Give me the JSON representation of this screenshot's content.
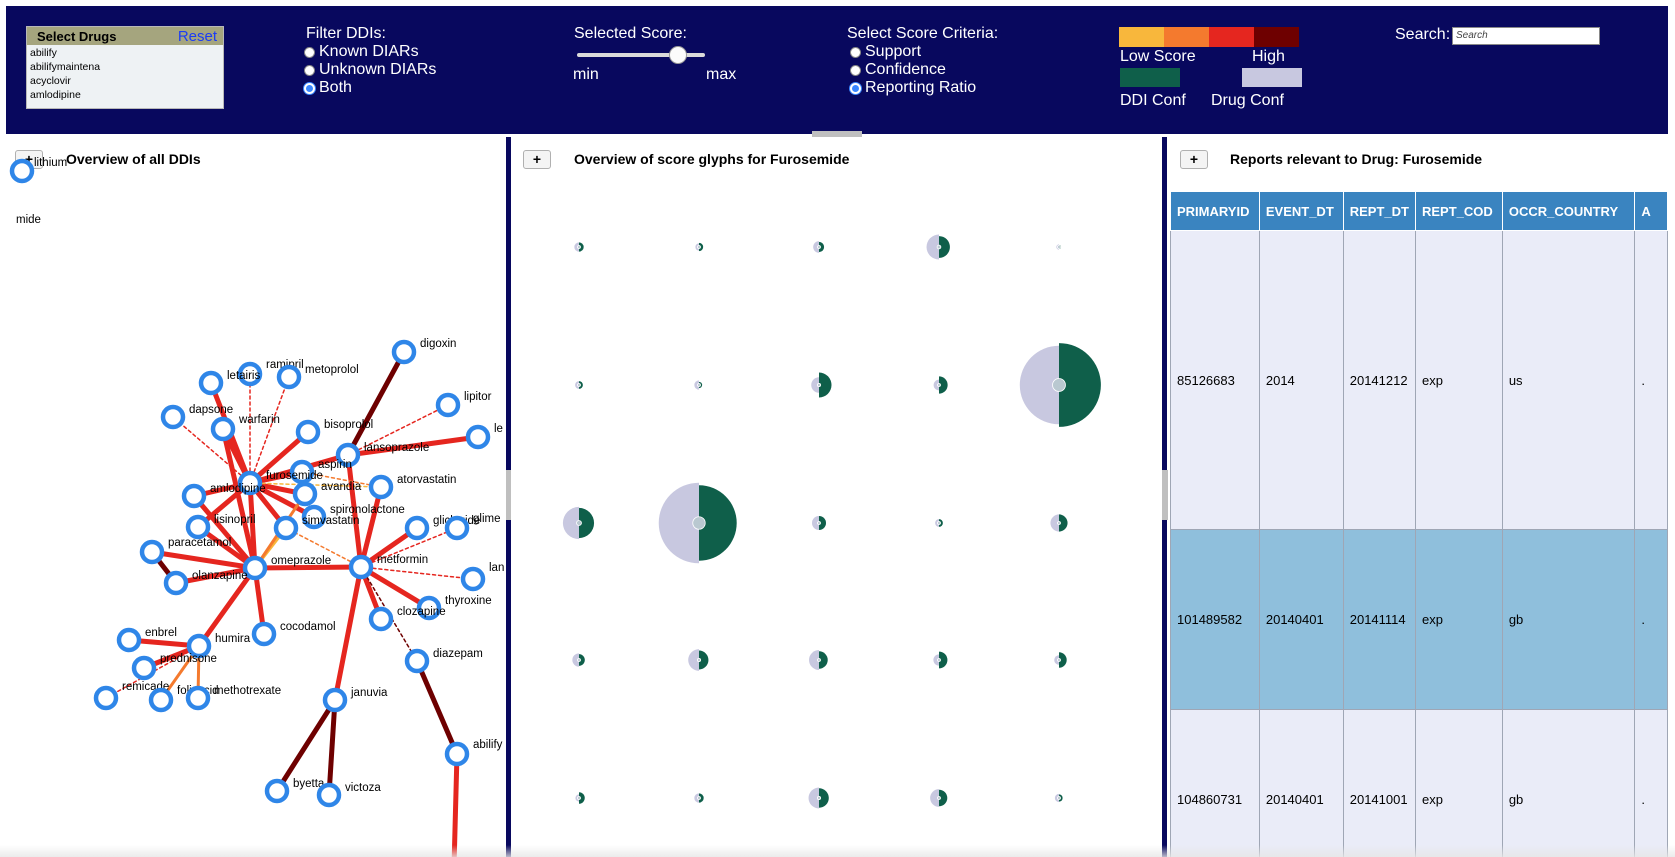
{
  "header": {
    "select_drugs": {
      "title": "Select Drugs",
      "reset_label": "Reset",
      "items": [
        "abilify",
        "abilifymaintena",
        "acyclovir",
        "amlodipine"
      ]
    },
    "filter_ddis": {
      "title": "Filter DDIs:",
      "options": [
        "Known DIARs",
        "Unknown DIARs",
        "Both"
      ],
      "selected": "Both"
    },
    "score": {
      "title": "Selected Score:",
      "min_label": "min",
      "max_label": "max",
      "level": 0.78
    },
    "criteria": {
      "title": "Select Score Criteria:",
      "options": [
        "Support",
        "Confidence",
        "Reporting Ratio"
      ],
      "selected": "Reporting Ratio"
    },
    "legend": {
      "scale_colors": [
        "#f8b73c",
        "#f47a2e",
        "#e5261f",
        "#6e0000"
      ],
      "low_label": "Low Score",
      "high_label": "High",
      "ddi_conf_label": "DDI Conf",
      "drug_conf_label": "Drug Conf",
      "ddi_conf_color": "#0f5f4a",
      "drug_conf_color": "#c8c8e0"
    },
    "search": {
      "label": "Search:",
      "placeholder": "Search"
    }
  },
  "panels": {
    "left_title": "Overview of all DDIs",
    "mid_title": "Overview of score glyphs for Furosemide",
    "right_title": "Reports relevant to Drug: Furosemide",
    "expand_label": "+"
  },
  "network": {
    "nodes": [
      {
        "id": "lithium",
        "label": "lithium"
      },
      {
        "id": "furosemide_partial",
        "label": "mide"
      },
      {
        "id": "digoxin",
        "label": "digoxin"
      },
      {
        "id": "ramipril",
        "label": "ramipril"
      },
      {
        "id": "letairis",
        "label": "letairis"
      },
      {
        "id": "metoprolol",
        "label": "metoprolol"
      },
      {
        "id": "lipitor",
        "label": "lipitor"
      },
      {
        "id": "dapsone",
        "label": "dapsone"
      },
      {
        "id": "warfarin",
        "label": "warfarin"
      },
      {
        "id": "bisoprolol",
        "label": "bisoprolol"
      },
      {
        "id": "le",
        "label": "le"
      },
      {
        "id": "lansoprazole",
        "label": "lansoprazole"
      },
      {
        "id": "aspirin",
        "label": "aspirin"
      },
      {
        "id": "furosemide",
        "label": "furosemide"
      },
      {
        "id": "amlodipine",
        "label": "amlodipine"
      },
      {
        "id": "avandia",
        "label": "avandia"
      },
      {
        "id": "atorvastatin",
        "label": "atorvastatin"
      },
      {
        "id": "spironolactone",
        "label": "spironolactone"
      },
      {
        "id": "lisinopril",
        "label": "lisinopril"
      },
      {
        "id": "simvastatin",
        "label": "simvastatin"
      },
      {
        "id": "gliclazide",
        "label": "gliclazide"
      },
      {
        "id": "glime",
        "label": "glime"
      },
      {
        "id": "paracetamol",
        "label": "paracetamol"
      },
      {
        "id": "omeprazole",
        "label": "omeprazole"
      },
      {
        "id": "metformin",
        "label": "metformin"
      },
      {
        "id": "olanzapine",
        "label": "olanzapine"
      },
      {
        "id": "lan",
        "label": "lan"
      },
      {
        "id": "thyroxine",
        "label": "thyroxine"
      },
      {
        "id": "clozapine",
        "label": "clozapine"
      },
      {
        "id": "cocodamol",
        "label": "cocodamol"
      },
      {
        "id": "enbrel",
        "label": "enbrel"
      },
      {
        "id": "humira",
        "label": "humira"
      },
      {
        "id": "prednisone",
        "label": "prednisone"
      },
      {
        "id": "diazepam",
        "label": "diazepam"
      },
      {
        "id": "remicade",
        "label": "remicade"
      },
      {
        "id": "folicacid",
        "label": "folicacid"
      },
      {
        "id": "methotrexate",
        "label": "methotrexate"
      },
      {
        "id": "januvia",
        "label": "januvia"
      },
      {
        "id": "abilify",
        "label": "abilify"
      },
      {
        "id": "byetta",
        "label": "byetta"
      },
      {
        "id": "victoza",
        "label": "victoza"
      }
    ],
    "edges": [
      {
        "source": "furosemide",
        "target": "letairis",
        "level": "high",
        "style": "solid"
      },
      {
        "source": "furosemide",
        "target": "ramipril",
        "level": "high",
        "style": "dashed"
      },
      {
        "source": "furosemide",
        "target": "metoprolol",
        "level": "high",
        "style": "dashed"
      },
      {
        "source": "furosemide",
        "target": "dapsone",
        "level": "high",
        "style": "dashed"
      },
      {
        "source": "furosemide",
        "target": "warfarin",
        "level": "high",
        "style": "solid"
      },
      {
        "source": "furosemide",
        "target": "bisoprolol",
        "level": "high",
        "style": "solid"
      },
      {
        "source": "furosemide",
        "target": "lansoprazole",
        "level": "high",
        "style": "solid"
      },
      {
        "source": "furosemide",
        "target": "aspirin",
        "level": "high",
        "style": "solid"
      },
      {
        "source": "furosemide",
        "target": "amlodipine",
        "level": "high",
        "style": "solid"
      },
      {
        "source": "furosemide",
        "target": "avandia",
        "level": "high",
        "style": "solid"
      },
      {
        "source": "furosemide",
        "target": "atorvastatin",
        "level": "low",
        "style": "dashed"
      },
      {
        "source": "furosemide",
        "target": "lisinopril",
        "level": "high",
        "style": "solid"
      },
      {
        "source": "furosemide",
        "target": "simvastatin",
        "level": "high",
        "style": "solid"
      },
      {
        "source": "furosemide",
        "target": "omeprazole",
        "level": "high",
        "style": "solid"
      },
      {
        "source": "furosemide",
        "target": "spironolactone",
        "level": "high",
        "style": "solid"
      },
      {
        "source": "lansoprazole",
        "target": "digoxin",
        "level": "max",
        "style": "solid"
      },
      {
        "source": "lansoprazole",
        "target": "le",
        "level": "high",
        "style": "solid"
      },
      {
        "source": "lansoprazole",
        "target": "lipitor",
        "level": "high",
        "style": "dashed"
      },
      {
        "source": "lansoprazole",
        "target": "metformin",
        "level": "high",
        "style": "solid"
      },
      {
        "source": "metformin",
        "target": "atorvastatin",
        "level": "high",
        "style": "solid"
      },
      {
        "source": "metformin",
        "target": "gliclazide",
        "level": "high",
        "style": "solid"
      },
      {
        "source": "metformin",
        "target": "glime",
        "level": "high",
        "style": "dashed"
      },
      {
        "source": "metformin",
        "target": "lan",
        "level": "high",
        "style": "dashed"
      },
      {
        "source": "metformin",
        "target": "thyroxine",
        "level": "high",
        "style": "solid"
      },
      {
        "source": "metformin",
        "target": "clozapine",
        "level": "high",
        "style": "solid"
      },
      {
        "source": "metformin",
        "target": "diazepam",
        "level": "max",
        "style": "dashed"
      },
      {
        "source": "metformin",
        "target": "januvia",
        "level": "high",
        "style": "solid"
      },
      {
        "source": "metformin",
        "target": "omeprazole",
        "level": "high",
        "style": "solid"
      },
      {
        "source": "metformin",
        "target": "simvastatin",
        "level": "mid",
        "style": "dashed"
      },
      {
        "source": "omeprazole",
        "target": "amlodipine",
        "level": "high",
        "style": "solid"
      },
      {
        "source": "omeprazole",
        "target": "lisinopril",
        "level": "high",
        "style": "solid"
      },
      {
        "source": "omeprazole",
        "target": "paracetamol",
        "level": "high",
        "style": "solid"
      },
      {
        "source": "omeprazole",
        "target": "olanzapine",
        "level": "high",
        "style": "solid"
      },
      {
        "source": "omeprazole",
        "target": "cocodamol",
        "level": "high",
        "style": "solid"
      },
      {
        "source": "omeprazole",
        "target": "humira",
        "level": "high",
        "style": "solid"
      },
      {
        "source": "omeprazole",
        "target": "simvastatin",
        "level": "low",
        "style": "solid"
      },
      {
        "source": "omeprazole",
        "target": "avandia",
        "level": "mid",
        "style": "solid"
      },
      {
        "source": "omeprazole",
        "target": "warfarin",
        "level": "high",
        "style": "solid"
      },
      {
        "source": "olanzapine",
        "target": "paracetamol",
        "level": "max",
        "style": "solid"
      },
      {
        "source": "humira",
        "target": "enbrel",
        "level": "high",
        "style": "solid"
      },
      {
        "source": "humira",
        "target": "prednisone",
        "level": "high",
        "style": "solid"
      },
      {
        "source": "humira",
        "target": "folicacid",
        "level": "mid",
        "style": "solid"
      },
      {
        "source": "humira",
        "target": "methotrexate",
        "level": "mid",
        "style": "solid"
      },
      {
        "source": "humira",
        "target": "remicade",
        "level": "high",
        "style": "dashed"
      },
      {
        "source": "januvia",
        "target": "byetta",
        "level": "max",
        "style": "solid"
      },
      {
        "source": "januvia",
        "target": "victoza",
        "level": "max",
        "style": "solid"
      },
      {
        "source": "diazepam",
        "target": "abilify",
        "level": "max",
        "style": "solid"
      },
      {
        "source": "abilify",
        "target": "abilify_bottom",
        "level": "high",
        "style": "solid"
      },
      {
        "source": "aspirin",
        "target": "atorvastatin",
        "level": "mid",
        "style": "dashed"
      }
    ]
  },
  "glyphs": {
    "rows": [
      [
        {
          "size": 0.06,
          "ddi": 0.5,
          "drug": 0.5
        },
        {
          "size": 0.05,
          "ddi": 0.6,
          "drug": 0.4
        },
        {
          "size": 0.07,
          "ddi": 0.4,
          "drug": 0.6
        },
        {
          "size": 0.15,
          "ddi": 0.4,
          "drug": 0.6
        },
        {
          "size": 0.03,
          "ddi": 0.3,
          "drug": 0.7
        }
      ],
      [
        {
          "size": 0.05,
          "ddi": 0.5,
          "drug": 0.5
        },
        {
          "size": 0.05,
          "ddi": 0.2,
          "drug": 0.8
        },
        {
          "size": 0.13,
          "ddi": 0.85,
          "drug": 0.15
        },
        {
          "size": 0.09,
          "ddi": 0.85,
          "drug": 0.15
        },
        {
          "size": 0.52,
          "ddi": 0.55,
          "drug": 0.45
        }
      ],
      [
        {
          "size": 0.2,
          "ddi": 0.45,
          "drug": 0.55
        },
        {
          "size": 0.5,
          "ddi": 0.45,
          "drug": 0.55
        },
        {
          "size": 0.09,
          "ddi": 0.5,
          "drug": 0.5
        },
        {
          "size": 0.05,
          "ddi": 0.5,
          "drug": 0.5
        },
        {
          "size": 0.11,
          "ddi": 0.5,
          "drug": 0.5
        }
      ],
      [
        {
          "size": 0.08,
          "ddi": 0.4,
          "drug": 0.6
        },
        {
          "size": 0.13,
          "ddi": 0.4,
          "drug": 0.6
        },
        {
          "size": 0.12,
          "ddi": 0.4,
          "drug": 0.6
        },
        {
          "size": 0.09,
          "ddi": 0.8,
          "drug": 0.2
        },
        {
          "size": 0.08,
          "ddi": 0.85,
          "drug": 0.15
        }
      ],
      [
        {
          "size": 0.06,
          "ddi": 0.85,
          "drug": 0.15
        },
        {
          "size": 0.06,
          "ddi": 0.5,
          "drug": 0.5
        },
        {
          "size": 0.13,
          "ddi": 0.45,
          "drug": 0.55
        },
        {
          "size": 0.11,
          "ddi": 0.45,
          "drug": 0.55
        },
        {
          "size": 0.05,
          "ddi": 0.4,
          "drug": 0.6
        }
      ]
    ]
  },
  "reports": {
    "columns": [
      "PRIMARYID",
      "EVENT_DT",
      "REPT_DT",
      "REPT_COD",
      "OCCR_COUNTRY",
      "A"
    ],
    "rows": [
      [
        "85126683",
        "2014",
        "20141212",
        "exp",
        "us",
        "."
      ],
      [
        "101489582",
        "20140401",
        "20141114",
        "exp",
        "gb",
        "."
      ],
      [
        "104860731",
        "20140401",
        "20141001",
        "exp",
        "gb",
        "."
      ]
    ]
  }
}
